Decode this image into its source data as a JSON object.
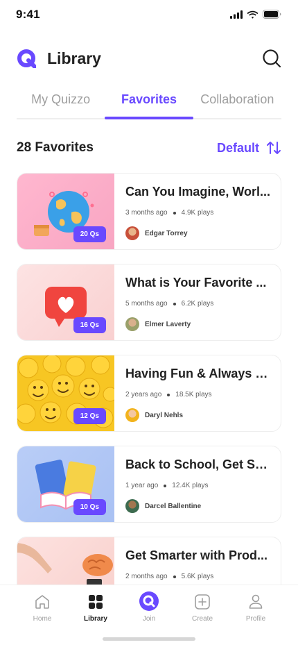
{
  "status_bar": {
    "time": "9:41"
  },
  "header": {
    "title": "Library"
  },
  "tabs": [
    {
      "label": "My Quizzo",
      "active": false
    },
    {
      "label": "Favorites",
      "active": true
    },
    {
      "label": "Collaboration",
      "active": false
    }
  ],
  "list_header": {
    "count_label": "28 Favorites",
    "sort_label": "Default"
  },
  "quizzes": [
    {
      "title": "Can You Imagine, Worl...",
      "questions": "20 Qs",
      "time_ago": "3 months ago",
      "plays": "4.9K plays",
      "author": "Edgar Torrey",
      "thumb_icon": "globe-icon"
    },
    {
      "title": "What is Your Favorite ...",
      "questions": "16 Qs",
      "time_ago": "5 months ago",
      "plays": "6.2K plays",
      "author": "Elmer Laverty",
      "thumb_icon": "heart-icon"
    },
    {
      "title": "Having Fun & Always S...",
      "questions": "12 Qs",
      "time_ago": "2 years ago",
      "plays": "18.5K plays",
      "author": "Daryl Nehls",
      "thumb_icon": "emoji-icon"
    },
    {
      "title": "Back to School, Get Sm...",
      "questions": "10 Qs",
      "time_ago": "1 year ago",
      "plays": "12.4K plays",
      "author": "Darcel Ballentine",
      "thumb_icon": "books-icon"
    },
    {
      "title": "Get Smarter with Prod...",
      "questions": "",
      "time_ago": "2 months ago",
      "plays": "5.6K plays",
      "author": "",
      "thumb_icon": "brain-icon"
    }
  ],
  "bottom_nav": [
    {
      "label": "Home",
      "icon": "home-icon",
      "active": false
    },
    {
      "label": "Library",
      "icon": "library-icon",
      "active": true
    },
    {
      "label": "Join",
      "icon": "join-icon",
      "active": false
    },
    {
      "label": "Create",
      "icon": "create-icon",
      "active": false
    },
    {
      "label": "Profile",
      "icon": "profile-icon",
      "active": false
    }
  ],
  "colors": {
    "primary": "#6949ff",
    "text": "#212121",
    "muted": "#9e9e9e"
  }
}
